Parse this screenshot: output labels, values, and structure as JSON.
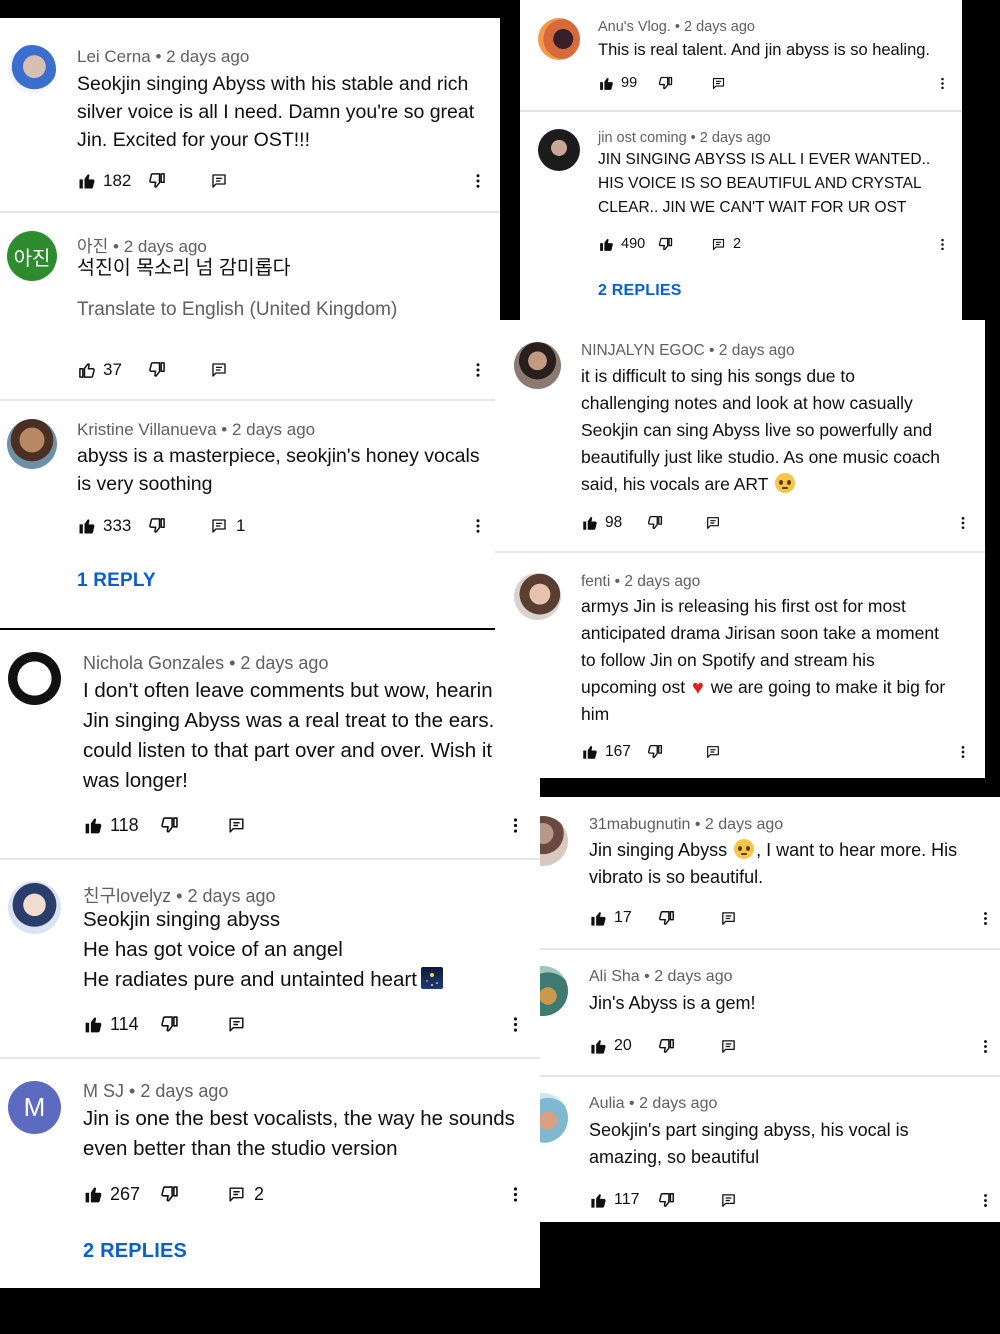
{
  "left_panel": {
    "comments": [
      {
        "author": "Lei Cerna",
        "sep": " • ",
        "time": "2 days ago",
        "lines": [
          "Seokjin singing Abyss with his stable and rich",
          "silver voice is all I need. Damn you're so great",
          "Jin. Excited for your OST!!!"
        ],
        "likes": "182",
        "reply_count": "",
        "replies_link": ""
      },
      {
        "author": "아진",
        "sep": " • ",
        "time": "2 days ago",
        "avatar_text": "아진",
        "lines": [
          "석진이 목소리 넘 감미롭다"
        ],
        "translate": "Translate to English (United Kingdom)",
        "likes": "37",
        "reply_count": "",
        "replies_link": ""
      },
      {
        "author": "Kristine Villanueva",
        "sep": " • ",
        "time": "2 days ago",
        "lines": [
          "abyss is a masterpiece, seokjin's honey vocals",
          "is very soothing"
        ],
        "likes": "333",
        "reply_count": "1",
        "replies_link": "1 REPLY"
      },
      {
        "author": "Nichola Gonzales",
        "sep": " • ",
        "time": "2 days ago",
        "lines": [
          "I don't often leave comments but wow, hearin",
          "Jin singing Abyss was a real treat to the ears.",
          "could listen to that part over and over. Wish it",
          "was longer!"
        ],
        "likes": "118",
        "reply_count": "",
        "replies_link": ""
      },
      {
        "author": "친구lovelyz",
        "sep": " • ",
        "time": "2 days ago",
        "lines": [
          "Seokjin singing abyss",
          "He has got voice of an angel",
          "He radiates pure and untainted heart"
        ],
        "likes": "114",
        "reply_count": "",
        "replies_link": ""
      },
      {
        "author": "M SJ",
        "sep": " • ",
        "time": "2 days ago",
        "avatar_text": "M",
        "lines": [
          "Jin is one the best vocalists, the way he sounds",
          "even better than the studio version"
        ],
        "likes": "267",
        "reply_count": "2",
        "replies_link": "2 REPLIES"
      }
    ]
  },
  "top_right_panel": {
    "comments": [
      {
        "author": "Anu's Vlog.",
        "sep": " • ",
        "time": "2 days ago",
        "lines": [
          "This is real talent.  And jin abyss is so healing."
        ],
        "likes": "99",
        "reply_count": "",
        "replies_link": ""
      },
      {
        "author": "jin ost coming",
        "sep": " • ",
        "time": "2 days ago",
        "lines": [
          "JIN SINGING ABYSS IS ALL I EVER WANTED..",
          "HIS VOICE IS SO BEAUTIFUL AND CRYSTAL",
          "CLEAR.. JIN WE CAN'T WAIT FOR UR OST"
        ],
        "likes": "490",
        "reply_count": "2",
        "replies_link": "2 REPLIES"
      }
    ]
  },
  "mid_right_panel": {
    "comments": [
      {
        "author": "NINJALYN EGOC",
        "sep": " • ",
        "time": "2 days ago",
        "lines": [
          "it is difficult to sing his songs due to",
          "challenging notes and look at how casually",
          "Seokjin can sing Abyss live so powerfully and",
          "beautifully just like studio. As one music coach",
          "said, his vocals are ART"
        ],
        "likes": "98",
        "reply_count": "",
        "replies_link": ""
      },
      {
        "author": "fenti",
        "sep": " • ",
        "time": "2 days ago",
        "lines": [
          "armys Jin is releasing his first ost for most",
          "anticipated drama Jirisan soon take a moment",
          "to follow Jin on Spotify and stream his",
          "upcoming ost",
          "we are going to make it big for",
          "him"
        ],
        "likes": "167",
        "reply_count": "",
        "replies_link": ""
      }
    ]
  },
  "bottom_right_panel": {
    "comments": [
      {
        "author": "31mabugnutin",
        "sep": " • ",
        "time": "2 days ago",
        "lines": [
          "Jin singing Abyss",
          ", I want to hear more. His",
          "vibrato is so beautiful."
        ],
        "likes": "17",
        "reply_count": "",
        "replies_link": ""
      },
      {
        "author": "Ali Sha",
        "sep": " • ",
        "time": "2 days ago",
        "lines": [
          "Jin's Abyss is a gem!"
        ],
        "likes": "20",
        "reply_count": "",
        "replies_link": ""
      },
      {
        "author": "Aulia",
        "sep": " • ",
        "time": "2 days ago",
        "lines": [
          "Seokjin's part singing abyss, his vocal is",
          "amazing, so beautiful"
        ],
        "likes": "117",
        "reply_count": "",
        "replies_link": ""
      }
    ]
  },
  "icons": [
    "thumb-up-filled-icon",
    "thumb-up-outline-icon",
    "thumb-down-icon",
    "reply-icon",
    "more-vert-icon"
  ],
  "colors": {
    "link_blue": "#065fd4",
    "meta_gray": "#606060",
    "text": "#0f0f0f",
    "divider": "#e6e6e6",
    "background": "#000000"
  }
}
